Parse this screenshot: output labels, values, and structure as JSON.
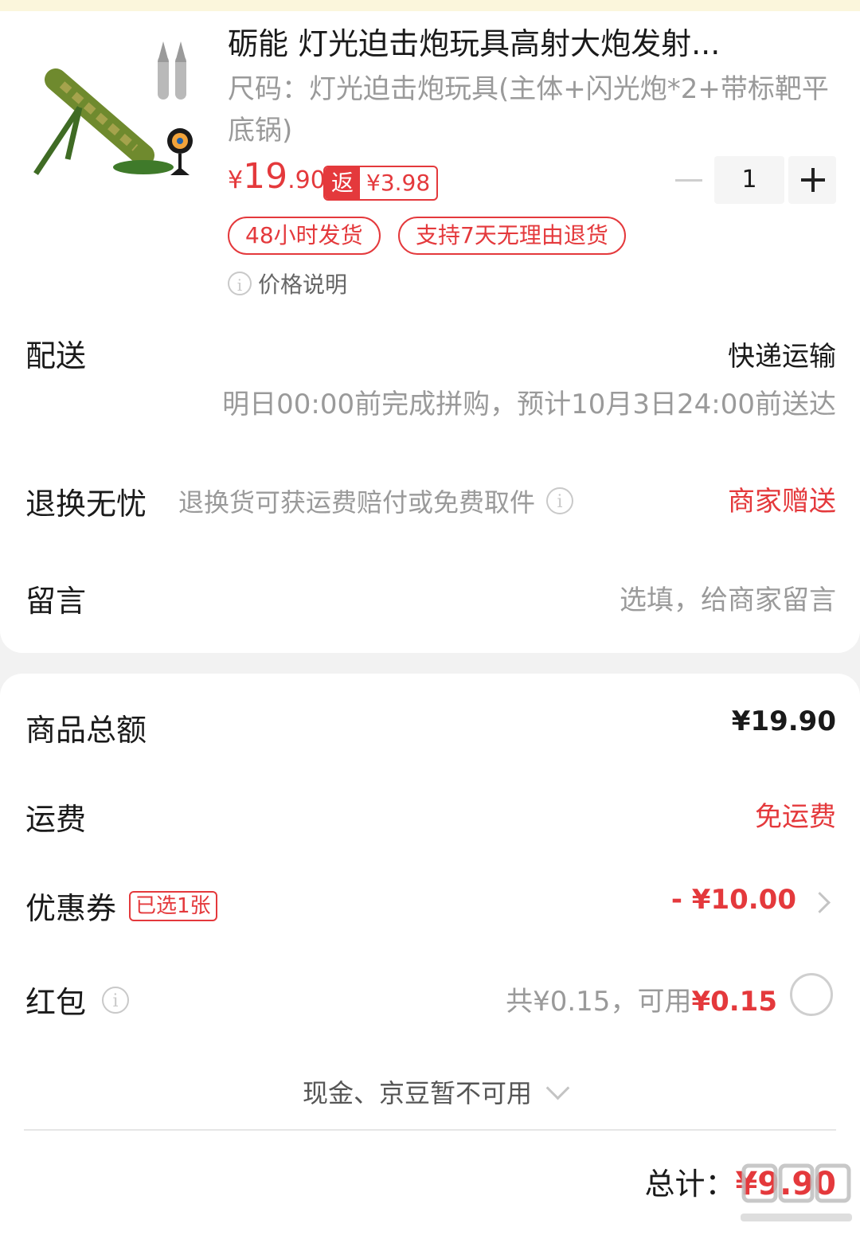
{
  "product": {
    "title": "砺能 灯光迫击炮玩具高射大炮发射...",
    "spec": "尺码：灯光迫击炮玩具(主体+闪光炮*2+带标靶平底锅)",
    "price_currency": "¥",
    "price_int": "19",
    "price_dec": ".90",
    "rebate_label": "返",
    "rebate_amount": "¥3.98",
    "quantity": "1",
    "tags": [
      "48小时发货",
      "支持7天无理由退货"
    ],
    "price_note": "价格说明"
  },
  "delivery": {
    "label": "配送",
    "method": "快递运输",
    "estimate": "明日00:00前完成拼购，预计10月3日24:00前送达"
  },
  "returns": {
    "label": "退换无忧",
    "desc": "退换货可获运费赔付或免费取件",
    "value": "商家赠送"
  },
  "message": {
    "label": "留言",
    "placeholder": "选填，给商家留言"
  },
  "summary": {
    "goods_total_label": "商品总额",
    "goods_total": "¥19.90",
    "shipping_label": "运费",
    "shipping_value": "免运费",
    "coupon_label": "优惠券",
    "coupon_badge": "已选1张",
    "coupon_value": "- ¥10.00",
    "redpacket_label": "红包",
    "redpacket_total": "共¥0.15，可用",
    "redpacket_available": "¥0.15",
    "cash_note": "现金、京豆暂不可用",
    "total_label": "总计：",
    "total_value": "¥9.90"
  },
  "colors": {
    "accent": "#e4393c",
    "muted": "#9a9a9a"
  }
}
